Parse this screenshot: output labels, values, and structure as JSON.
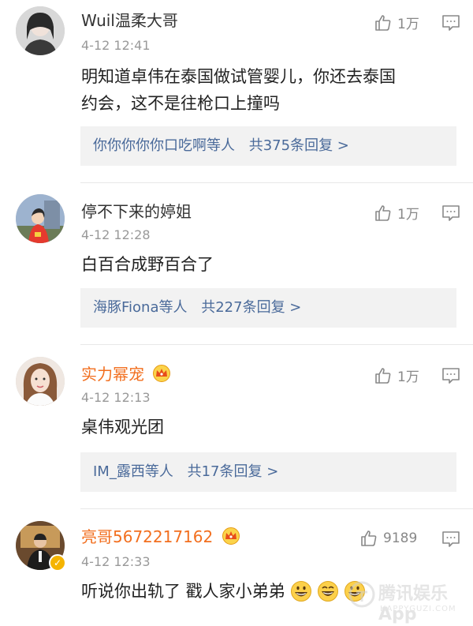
{
  "comments": [
    {
      "username": "Wuil温柔大哥",
      "timestamp": "4-12 12:41",
      "likes": "1万",
      "text_line1": "明知道卓伟在泰国做试管婴儿，你还去泰国",
      "text_line2": "约会，这不是往枪口上撞吗",
      "replies_users": "你你你你你口吃啊等人",
      "replies_count": "共375条回复 >"
    },
    {
      "username": "停不下来的婷姐",
      "timestamp": "4-12 12:28",
      "likes": "1万",
      "text_line1": "白百合成野百合了",
      "replies_users": "海豚Fiona等人",
      "replies_count": "共227条回复 >"
    },
    {
      "username": "实力幂宠",
      "timestamp": "4-12 12:13",
      "likes": "1万",
      "text_line1": "桌伟观光团",
      "replies_users": "IM_露西等人",
      "replies_count": "共17条回复 >"
    },
    {
      "username": "亮哥5672217162",
      "timestamp": "4-12 12:33",
      "likes": "9189",
      "text_line1": "听说你出轨了 戳人家小弟弟"
    }
  ],
  "watermark": {
    "text": "腾讯娱乐App",
    "sub": "HAPPYGUZI.COM"
  },
  "colors": {
    "vip_name": "#f26f1f",
    "reply_link": "#4a6a9a",
    "reply_bg": "#f2f2f2",
    "timestamp": "#999999"
  },
  "icons": {
    "like": "thumbs-up-icon",
    "reply": "comment-bubble-icon",
    "crown": "crown-icon",
    "verified": "verified-badge-icon",
    "emoji": "grinning-emoji-icon"
  }
}
